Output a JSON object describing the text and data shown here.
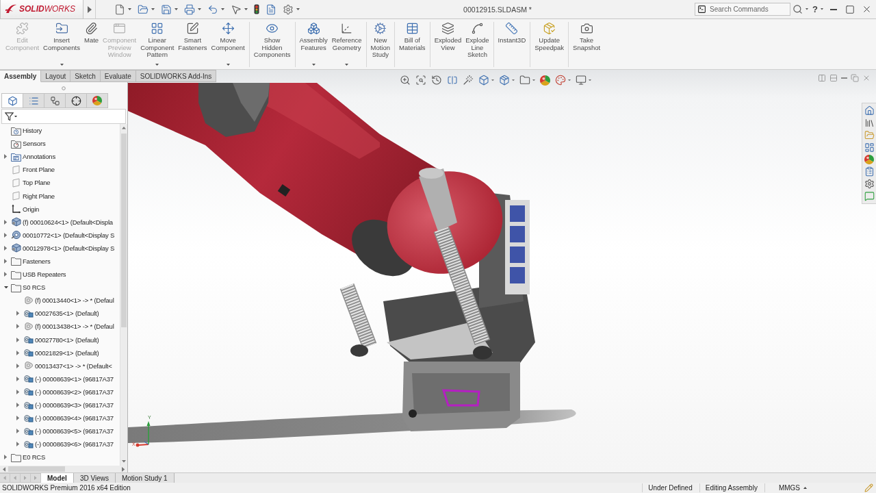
{
  "title_bar": {
    "logo": "**SOLID**WORKS",
    "document_title": "00012915.SLDASM *",
    "search": {
      "placeholder": "Search Commands"
    },
    "help": "?"
  },
  "quick_access": [
    {
      "dropdown": true
    },
    {
      "dropdown": true
    },
    {
      "dropdown": true
    },
    {
      "dropdown": true
    },
    {
      "dropdown": true
    },
    {
      "dropdown": true
    },
    {
      "dropdown": false
    },
    {
      "dropdown": false
    },
    {
      "dropdown": true
    }
  ],
  "ribbon": {
    "groups": [
      {
        "items": [
          {
            "label": "Edit Component",
            "disabled": true,
            "dropdown": false
          },
          {
            "label": "Insert Components",
            "disabled": false,
            "dropdown": true
          },
          {
            "label": "Mate",
            "disabled": false,
            "dropdown": false
          },
          {
            "label": "Component Preview Window",
            "disabled": true,
            "dropdown": false
          },
          {
            "label": "Linear Component Pattern",
            "disabled": false,
            "dropdown": true
          },
          {
            "label": "Smart Fasteners",
            "disabled": false,
            "dropdown": false
          },
          {
            "label": "Move Component",
            "disabled": false,
            "dropdown": true
          }
        ]
      },
      {
        "items": [
          {
            "label": "Show Hidden Components",
            "disabled": false,
            "dropdown": false
          }
        ]
      },
      {
        "items": [
          {
            "label": "Assembly Features",
            "disabled": false,
            "dropdown": true
          },
          {
            "label": "Reference Geometry",
            "disabled": false,
            "dropdown": true
          }
        ]
      },
      {
        "items": [
          {
            "label": "New Motion Study",
            "disabled": false,
            "dropdown": false
          }
        ]
      },
      {
        "items": [
          {
            "label": "Bill of Materials",
            "disabled": false,
            "dropdown": false
          }
        ]
      },
      {
        "items": [
          {
            "label": "Exploded View",
            "disabled": false,
            "dropdown": false
          },
          {
            "label": "Explode Line Sketch",
            "disabled": false,
            "dropdown": false
          }
        ]
      },
      {
        "items": [
          {
            "label": "Instant3D",
            "disabled": false,
            "dropdown": false
          }
        ]
      },
      {
        "items": [
          {
            "label": "Update Speedpak",
            "disabled": false,
            "dropdown": false
          }
        ]
      },
      {
        "items": [
          {
            "label": "Take Snapshot",
            "disabled": false,
            "dropdown": false
          }
        ]
      }
    ]
  },
  "command_tabs": [
    {
      "label": "Assembly",
      "selected": true
    },
    {
      "label": "Layout",
      "selected": false
    },
    {
      "label": "Sketch",
      "selected": false
    },
    {
      "label": "Evaluate",
      "selected": false
    },
    {
      "label": "SOLIDWORKS Add-Ins",
      "selected": false
    }
  ],
  "view_toolbar": [
    {
      "dropdown": false
    },
    {
      "dropdown": false
    },
    {
      "dropdown": false
    },
    {
      "dropdown": false
    },
    {
      "dropdown": false
    },
    {
      "dropdown": true
    },
    {
      "dropdown": true
    },
    {
      "dropdown": true
    },
    {
      "dropdown": false
    },
    {
      "dropdown": true
    },
    {
      "dropdown": true
    }
  ],
  "axis_triad": {
    "y_label": "Y",
    "x_label": "X"
  },
  "feature_tree": {
    "tabs": [
      {
        "selected": true
      },
      {
        "selected": false
      },
      {
        "selected": false
      },
      {
        "selected": false
      },
      {
        "selected": false
      }
    ],
    "items": [
      {
        "label": "History",
        "kind": "history"
      },
      {
        "label": "Sensors",
        "kind": "sensors"
      },
      {
        "label": "Annotations",
        "kind": "annotations",
        "expanded": false
      },
      {
        "label": "Front Plane",
        "kind": "plane"
      },
      {
        "label": "Top Plane",
        "kind": "plane"
      },
      {
        "label": "Right Plane",
        "kind": "plane"
      },
      {
        "label": "Origin",
        "kind": "origin"
      },
      {
        "label": "(f) 00010624<1> (Default<Displa",
        "kind": "assembly",
        "expanded": false
      },
      {
        "label": "00010772<1> (Default<Display S",
        "kind": "ring_assembly",
        "expanded": false
      },
      {
        "label": "00012978<1> (Default<Display S",
        "kind": "assembly",
        "expanded": false
      },
      {
        "label": "Fasteners",
        "kind": "folder",
        "expanded": false
      },
      {
        "label": "USB Repeaters",
        "kind": "folder",
        "expanded": false
      },
      {
        "label": "S0 RCS",
        "kind": "folder",
        "expanded": true,
        "children": [
          {
            "label": "(f) 00013440<1> -> * (Defaul",
            "kind": "part"
          },
          {
            "label": "00027635<1> (Default)",
            "kind": "subassembly",
            "expanded": false
          },
          {
            "label": "(f) 00013438<1> -> * (Defaul",
            "kind": "part",
            "expanded": false
          },
          {
            "label": "00027780<1> (Default)",
            "kind": "subassembly",
            "expanded": false
          },
          {
            "label": "00021829<1> (Default)",
            "kind": "subassembly",
            "expanded": false
          },
          {
            "label": "00013437<1> -> * (Default<",
            "kind": "part",
            "expanded": false
          },
          {
            "label": "(-) 00008639<1> (96817A37",
            "kind": "subassembly",
            "expanded": false
          },
          {
            "label": "(-) 00008639<2> (96817A37",
            "kind": "subassembly",
            "expanded": false
          },
          {
            "label": "(-) 00008639<3> (96817A37",
            "kind": "subassembly",
            "expanded": false
          },
          {
            "label": "(-) 00008639<4> (96817A37",
            "kind": "subassembly",
            "expanded": false
          },
          {
            "label": "(-) 00008639<5> (96817A37",
            "kind": "subassembly",
            "expanded": false
          },
          {
            "label": "(-) 00008639<6> (96817A37",
            "kind": "subassembly",
            "expanded": false
          }
        ]
      },
      {
        "label": "E0 RCS",
        "kind": "folder",
        "expanded": false
      }
    ]
  },
  "document_tabs": [
    {
      "label": "Model",
      "selected": true
    },
    {
      "label": "3D Views",
      "selected": false
    },
    {
      "label": "Motion Study 1",
      "selected": false
    }
  ],
  "status_bar": {
    "product": "SOLIDWORKS Premium 2016 x64 Edition",
    "state": "Under Defined",
    "mode": "Editing Assembly",
    "units": "MMGS"
  }
}
